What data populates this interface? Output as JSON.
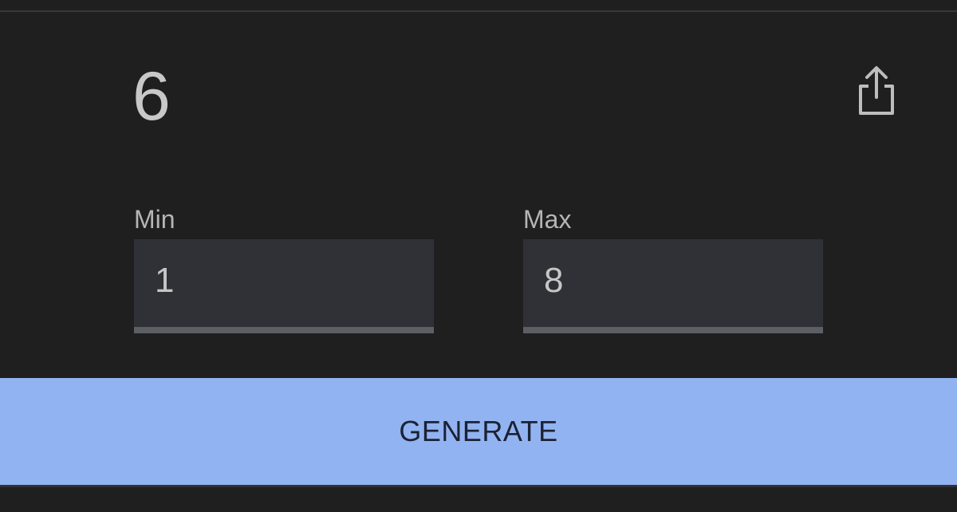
{
  "result": {
    "value": "6"
  },
  "toolbar": {
    "share_icon": "share-icon"
  },
  "inputs": {
    "min": {
      "label": "Min",
      "value": "1"
    },
    "max": {
      "label": "Max",
      "value": "8"
    }
  },
  "actions": {
    "generate_label": "GENERATE"
  },
  "colors": {
    "background": "#1f1f20",
    "field": "#303136",
    "underline": "#5d5f64",
    "button": "#92b3f1",
    "button_text": "#1b2233"
  }
}
